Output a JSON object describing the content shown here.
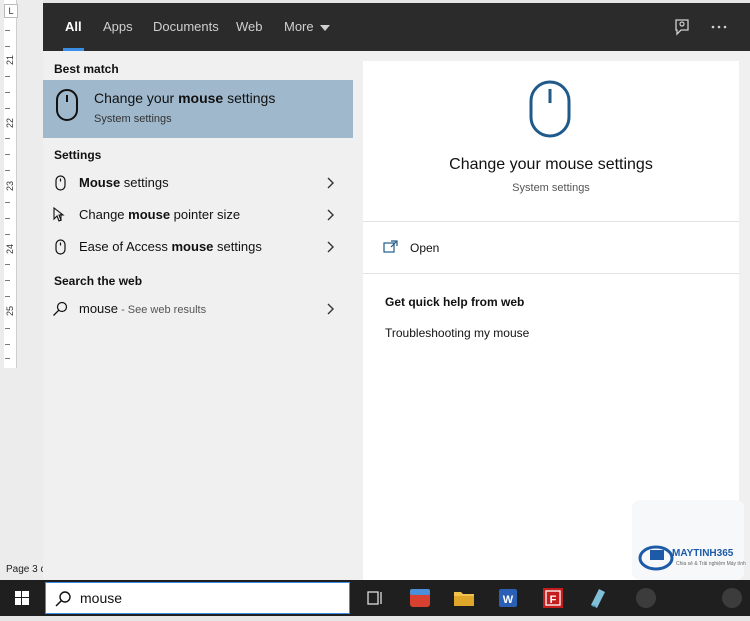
{
  "background": {
    "ruler_numbers": [
      "21",
      "22",
      "23",
      "24",
      "25"
    ],
    "ruler_corner": "L",
    "page_label": "Page 3 c"
  },
  "topbar": {
    "tabs": [
      {
        "label": "All",
        "active": true
      },
      {
        "label": "Apps"
      },
      {
        "label": "Documents"
      },
      {
        "label": "Web"
      },
      {
        "label": "More"
      }
    ],
    "feedback_icon": "feedback-icon",
    "more_options_icon": "ellipsis-icon"
  },
  "left": {
    "best_match_heading": "Best match",
    "best_match": {
      "title_pre": "Change your ",
      "title_bold": "mouse",
      "title_post": " settings",
      "subtitle": "System settings"
    },
    "settings_heading": "Settings",
    "settings_items": [
      {
        "pre": "",
        "bold": "Mouse",
        "post": " settings",
        "icon": "mouse-icon"
      },
      {
        "pre": "Change ",
        "bold": "mouse",
        "post": " pointer size",
        "icon": "pointer-icon"
      },
      {
        "pre": "Ease of Access ",
        "bold": "mouse",
        "post": " settings",
        "icon": "mouse-icon"
      }
    ],
    "web_heading": "Search the web",
    "web_item": {
      "query": "mouse",
      "hint": " - See web results"
    }
  },
  "right": {
    "title": "Change your mouse settings",
    "subtitle": "System settings",
    "open_label": "Open",
    "quick_help_heading": "Get quick help from web",
    "quick_help_link": "Troubleshooting my mouse"
  },
  "taskbar": {
    "search_value": "mouse",
    "apps": [
      "task-view-icon",
      "app-red-icon",
      "file-explorer-icon",
      "word-icon",
      "app-flash-icon",
      "app-notepad-icon"
    ]
  },
  "watermark": {
    "brand": "MAYTINH365",
    "tagline": "Chia sẻ & Trải nghiệm Máy tính"
  },
  "colors": {
    "accent": "#3b8ee6",
    "selected_bg": "#9fb8cc",
    "icon_blue": "#1f5a8a",
    "topbar_bg": "#2b2b2b",
    "taskbar_bg": "#1f1f1f"
  }
}
